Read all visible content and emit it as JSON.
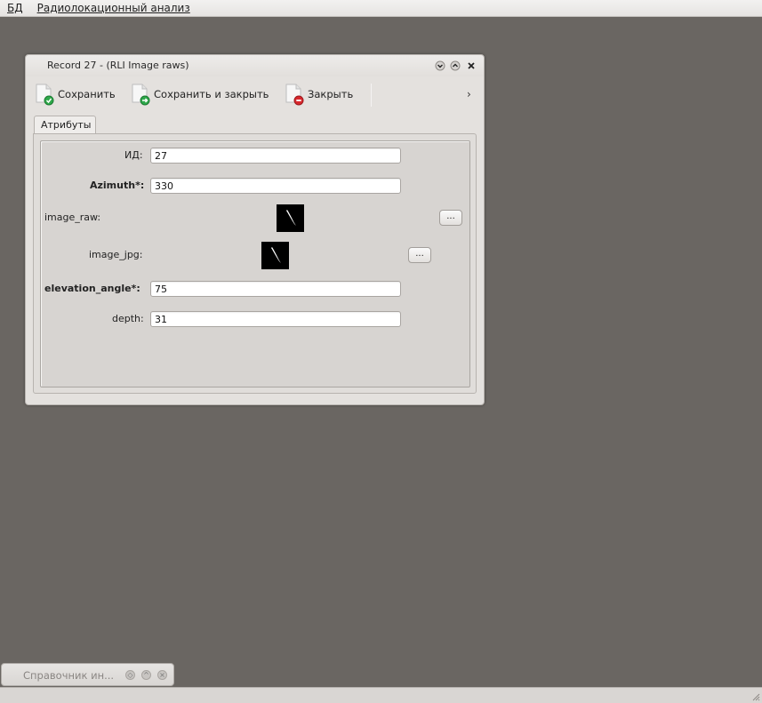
{
  "menubar": {
    "items": [
      {
        "label": "БД"
      },
      {
        "label": "Радиолокационный анализ"
      }
    ]
  },
  "window": {
    "title": "Record 27 - (RLI Image raws)",
    "toolbar": {
      "save_label": "Сохранить",
      "save_close_label": "Сохранить и закрыть",
      "close_label": "Закрыть",
      "more_label": "›"
    },
    "tab_label": "Атрибуты",
    "form": {
      "id_label": "ИД:",
      "id_value": "27",
      "azimuth_label": "Azimuth*:",
      "azimuth_value": "330",
      "image_raw_label": "image_raw:",
      "image_raw_button": "...",
      "image_jpg_label": "image_jpg:",
      "image_jpg_button": "...",
      "elevation_label": "elevation_angle*:",
      "elevation_value": "75",
      "depth_label": "depth:",
      "depth_value": "31"
    }
  },
  "minimized_window": {
    "title": "Справочник ин..."
  },
  "colors": {
    "desktop": "#6a6662",
    "window_bg": "#e4e1de",
    "save_icon_green": "#2ea84a",
    "close_icon_red": "#d8282d"
  }
}
